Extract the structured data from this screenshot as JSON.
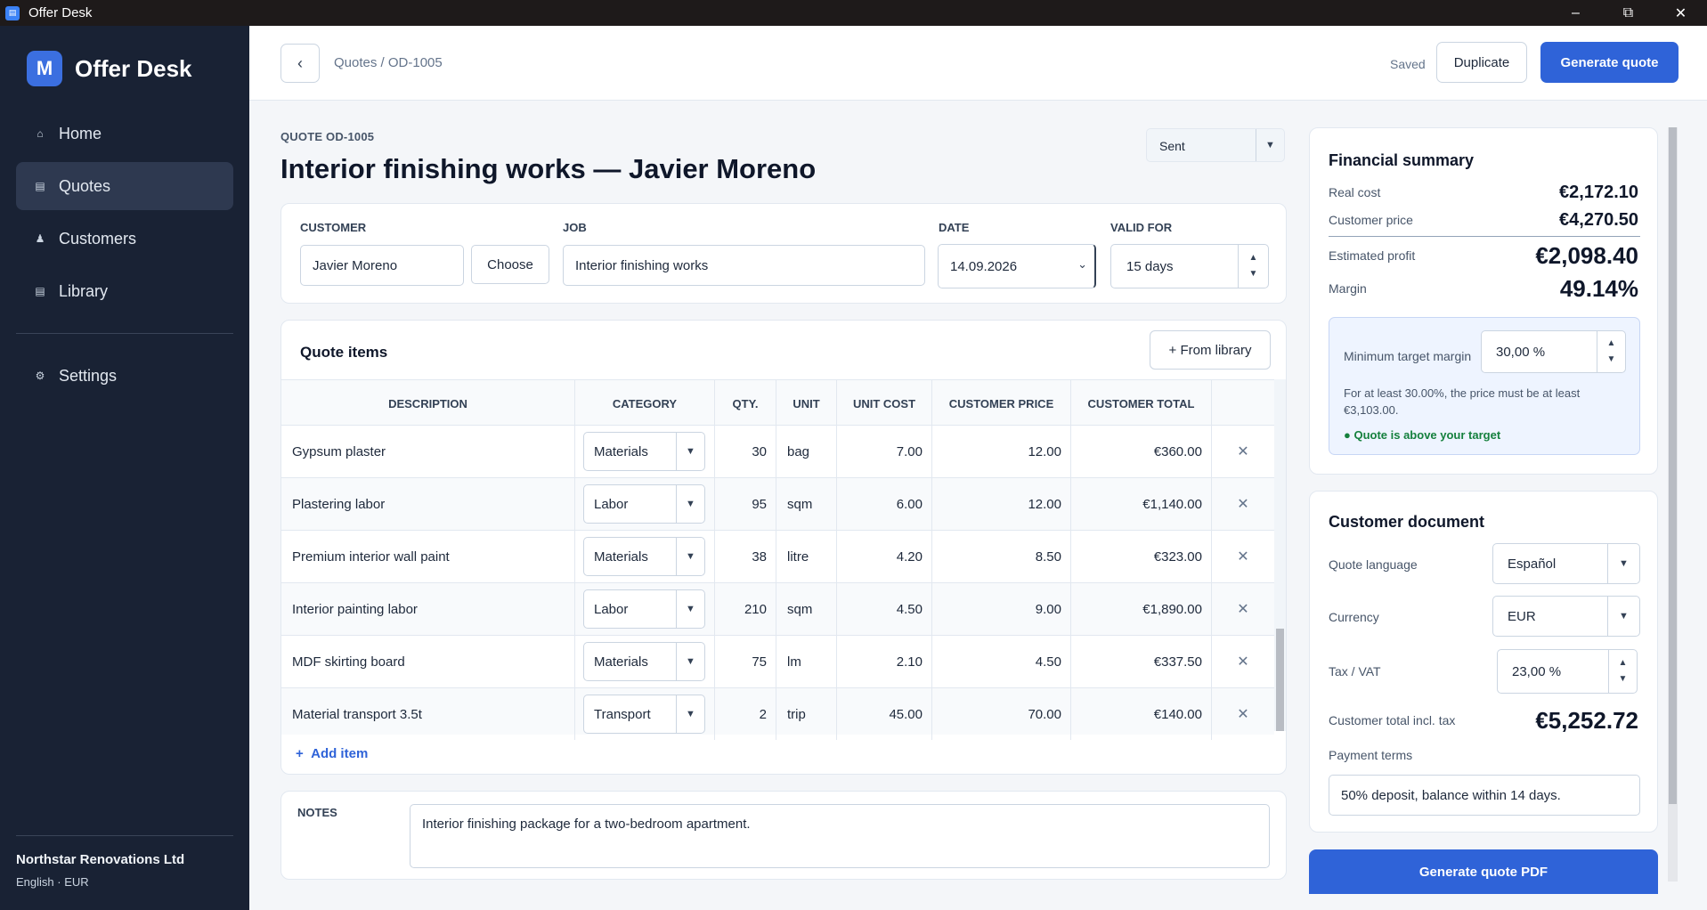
{
  "window": {
    "title": "Offer Desk"
  },
  "sidebar": {
    "brand_initial": "M",
    "brand_name": "Offer Desk",
    "items": [
      {
        "label": "Home",
        "icon": "home-icon"
      },
      {
        "label": "Quotes",
        "icon": "list-icon",
        "active": true
      },
      {
        "label": "Customers",
        "icon": "person-icon"
      },
      {
        "label": "Library",
        "icon": "book-icon"
      },
      {
        "label": "Settings",
        "icon": "gear-icon"
      }
    ],
    "org_name": "Northstar Renovations Ltd",
    "org_meta": "English · EUR"
  },
  "topbar": {
    "breadcrumb": "Quotes / OD-1005",
    "saved": "Saved",
    "duplicate": "Duplicate",
    "generate": "Generate quote"
  },
  "header": {
    "quote_label": "QUOTE OD-1005",
    "title": "Interior finishing works — Javier Moreno",
    "status": "Sent"
  },
  "details": {
    "customer_label": "CUSTOMER",
    "customer_value": "Javier Moreno",
    "choose": "Choose",
    "job_label": "JOB",
    "job_value": "Interior finishing works",
    "date_label": "DATE",
    "date_value": "14.09.2026",
    "valid_label": "VALID FOR",
    "valid_value": "15 days"
  },
  "items": {
    "title": "Quote items",
    "from_library": "+ From library",
    "columns": [
      "DESCRIPTION",
      "CATEGORY",
      "QTY.",
      "UNIT",
      "UNIT COST",
      "CUSTOMER PRICE",
      "CUSTOMER TOTAL"
    ],
    "rows": [
      {
        "description": "Gypsum plaster",
        "category": "Materials",
        "qty": "30",
        "unit": "bag",
        "unit_cost": "7.00",
        "price": "12.00",
        "total": "€360.00"
      },
      {
        "description": "Plastering labor",
        "category": "Labor",
        "qty": "95",
        "unit": "sqm",
        "unit_cost": "6.00",
        "price": "12.00",
        "total": "€1,140.00"
      },
      {
        "description": "Premium interior wall paint",
        "category": "Materials",
        "qty": "38",
        "unit": "litre",
        "unit_cost": "4.20",
        "price": "8.50",
        "total": "€323.00"
      },
      {
        "description": "Interior painting labor",
        "category": "Labor",
        "qty": "210",
        "unit": "sqm",
        "unit_cost": "4.50",
        "price": "9.00",
        "total": "€1,890.00"
      },
      {
        "description": "MDF skirting board",
        "category": "Materials",
        "qty": "75",
        "unit": "lm",
        "unit_cost": "2.10",
        "price": "4.50",
        "total": "€337.50"
      },
      {
        "description": "Material transport 3.5t",
        "category": "Transport",
        "qty": "2",
        "unit": "trip",
        "unit_cost": "45.00",
        "price": "70.00",
        "total": "€140.00"
      }
    ],
    "add_item": "Add item"
  },
  "notes": {
    "label": "NOTES",
    "value": "Interior finishing package for a two-bedroom apartment."
  },
  "financial": {
    "title": "Financial summary",
    "real_cost_label": "Real cost",
    "real_cost": "€2,172.10",
    "customer_price_label": "Customer price",
    "customer_price": "€4,270.50",
    "profit_label": "Estimated profit",
    "profit": "€2,098.40",
    "margin_label": "Margin",
    "margin": "49.14%",
    "target_label": "Minimum target margin",
    "target_value": "30,00 %",
    "target_note": "For at least 30.00%, the price must be at least €3,103.00.",
    "target_ok": "● Quote is above your target"
  },
  "document": {
    "title": "Customer document",
    "language_label": "Quote language",
    "language": "Español",
    "currency_label": "Currency",
    "currency": "EUR",
    "tax_label": "Tax / VAT",
    "tax": "23,00 %",
    "total_label": "Customer total incl. tax",
    "total": "€5,252.72",
    "payment_label": "Payment terms",
    "payment": "50% deposit, balance within 14 days."
  },
  "generate_pdf": "Generate quote PDF"
}
